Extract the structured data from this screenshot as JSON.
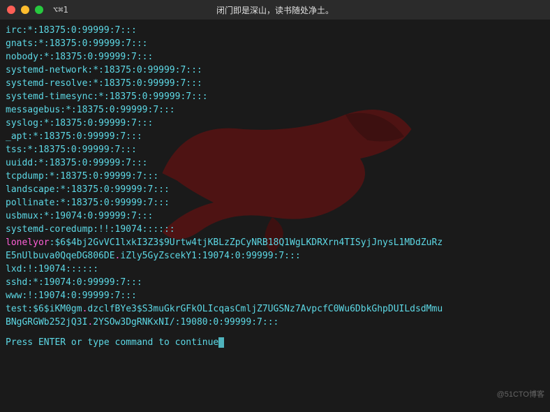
{
  "titlebar": {
    "tab_label": "⌥⌘1",
    "title": "闭门即是深山，读书随处净土。"
  },
  "shadow_lines": [
    {
      "text": "irc:*:18375:0:99999:7:::"
    },
    {
      "text": "gnats:*:18375:0:99999:7:::"
    },
    {
      "text": "nobody:*:18375:0:99999:7:::"
    },
    {
      "text": "systemd-network:*:18375:0:99999:7:::"
    },
    {
      "text": "systemd-resolve:*:18375:0:99999:7:::"
    },
    {
      "text": "systemd-timesync:*:18375:0:99999:7:::"
    },
    {
      "text": "messagebus:*:18375:0:99999:7:::"
    },
    {
      "text": "syslog:*:18375:0:99999:7:::"
    },
    {
      "text": "_apt:*:18375:0:99999:7:::"
    },
    {
      "text": "tss:*:18375:0:99999:7:::"
    },
    {
      "text": "uuidd:*:18375:0:99999:7:::"
    },
    {
      "text": "tcpdump:*:18375:0:99999:7:::"
    },
    {
      "text": "landscape:*:18375:0:99999:7:::"
    },
    {
      "text": "pollinate:*:18375:0:99999:7:::"
    },
    {
      "text": "usbmux:*:19074:0:99999:7:::"
    },
    {
      "text": "systemd-coredump:!!:19074::::::"
    }
  ],
  "lonelyor_line": {
    "user": "lonelyor",
    "seg1": ":$6$4bj2GvVC1lxkI3Z3$9Urtw4tjKBLzZpCyNRB18Q1WgLKDRXrn4TISyjJnysL1MDdZuRz",
    "seg2_pre": "E5nUlbuva0QqeDG806DE",
    "dot": ".",
    "seg2_post": "iZly5GyZscekY1:19074:0:99999:7:::"
  },
  "after_lonelyor": [
    {
      "text": "lxd:!:19074::::::"
    },
    {
      "text": "sshd:*:19074:0:99999:7:::"
    },
    {
      "text": "www:!:19074:0:99999:7:::"
    }
  ],
  "test_line": {
    "seg1_pre": "test:$6$iKM0gm",
    "dot1": ".",
    "seg1_post": "dzclfBYe3$S3muGkrGFkOLIcqasCmljZ7UGSNz7AvpcfC0Wu6DbkGhpDUILdsdMmu",
    "seg2_pre": "BNgGRGWb252jQ3I",
    "dot2": ".",
    "seg2_post": "2YSOw3DgRNKxNI/:19080:0:99999:7:::"
  },
  "prompt": "Press ENTER or type command to continue",
  "watermark": "@51CTO博客"
}
